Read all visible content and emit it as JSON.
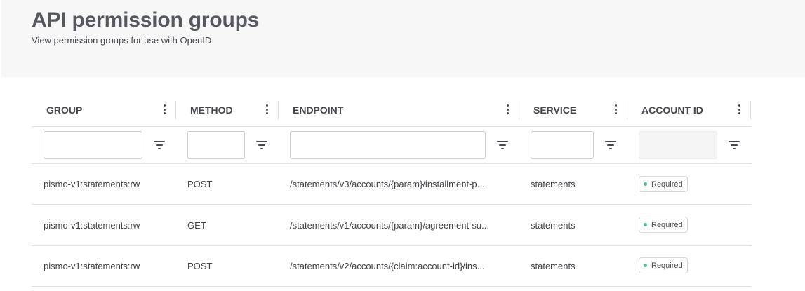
{
  "header": {
    "title": "API permission groups",
    "subtitle": "View permission groups for use with OpenID"
  },
  "columns": [
    {
      "label": "GROUP"
    },
    {
      "label": "METHOD"
    },
    {
      "label": "ENDPOINT"
    },
    {
      "label": "SERVICE"
    },
    {
      "label": "ACCOUNT ID"
    }
  ],
  "filters": {
    "group": "",
    "method": "",
    "endpoint": "",
    "service": "",
    "account_id": ""
  },
  "rows": [
    {
      "group": "pismo-v1:statements:rw",
      "method": "POST",
      "endpoint": "/statements/v3/accounts/{param}/installment-p...",
      "service": "statements",
      "account_id": "Required"
    },
    {
      "group": "pismo-v1:statements:rw",
      "method": "GET",
      "endpoint": "/statements/v1/accounts/{param}/agreement-su...",
      "service": "statements",
      "account_id": "Required"
    },
    {
      "group": "pismo-v1:statements:rw",
      "method": "POST",
      "endpoint": "/statements/v2/accounts/{claim:account-id}/ins...",
      "service": "statements",
      "account_id": "Required"
    }
  ],
  "colors": {
    "header_bg": "#f7f7f7",
    "status_dot": "#4fbf8a",
    "border": "#e2e2e2"
  }
}
